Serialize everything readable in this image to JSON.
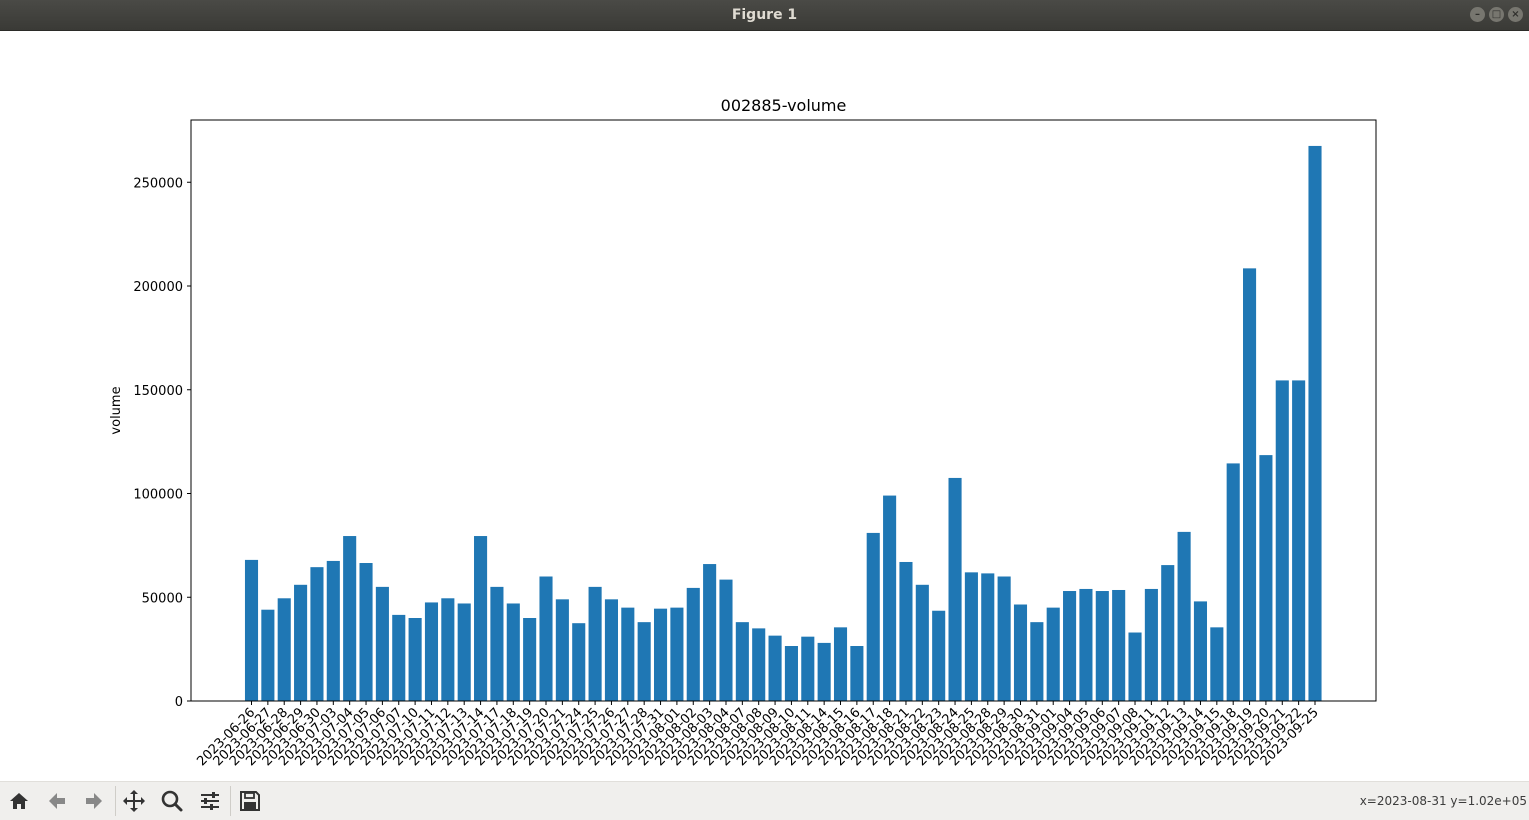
{
  "window": {
    "title": "Figure 1"
  },
  "colors": {
    "bar": "#1f77b4"
  },
  "toolbar": {
    "buttons": [
      "home-icon",
      "back-arrow-icon",
      "forward-arrow-icon",
      "pan-icon",
      "zoom-icon",
      "configure-subplots-icon",
      "save-icon"
    ],
    "coordinates": "x=2023-08-31 y=1.02e+05"
  },
  "chart_data": {
    "type": "bar",
    "title": "002885-volume",
    "xlabel": "",
    "ylabel": "volume",
    "ylim": [
      0,
      280000
    ],
    "yticks": [
      0,
      50000,
      100000,
      150000,
      200000,
      250000
    ],
    "grid": false,
    "categories": [
      "2023-06-26",
      "2023-06-27",
      "2023-06-28",
      "2023-06-29",
      "2023-06-30",
      "2023-07-03",
      "2023-07-04",
      "2023-07-05",
      "2023-07-06",
      "2023-07-07",
      "2023-07-10",
      "2023-07-11",
      "2023-07-12",
      "2023-07-13",
      "2023-07-14",
      "2023-07-17",
      "2023-07-18",
      "2023-07-19",
      "2023-07-20",
      "2023-07-21",
      "2023-07-24",
      "2023-07-25",
      "2023-07-26",
      "2023-07-27",
      "2023-07-28",
      "2023-07-31",
      "2023-08-01",
      "2023-08-02",
      "2023-08-03",
      "2023-08-04",
      "2023-08-07",
      "2023-08-08",
      "2023-08-09",
      "2023-08-10",
      "2023-08-11",
      "2023-08-14",
      "2023-08-15",
      "2023-08-16",
      "2023-08-17",
      "2023-08-18",
      "2023-08-21",
      "2023-08-22",
      "2023-08-23",
      "2023-08-24",
      "2023-08-25",
      "2023-08-28",
      "2023-08-29",
      "2023-08-30",
      "2023-08-31",
      "2023-09-01",
      "2023-09-04",
      "2023-09-05",
      "2023-09-06",
      "2023-09-07",
      "2023-09-08",
      "2023-09-11",
      "2023-09-12",
      "2023-09-13",
      "2023-09-14",
      "2023-09-15",
      "2023-09-18",
      "2023-09-19",
      "2023-09-20",
      "2023-09-21",
      "2023-09-22",
      "2023-09-25"
    ],
    "values": [
      68000,
      44000,
      49500,
      56000,
      64500,
      67500,
      79500,
      66500,
      55000,
      41500,
      40000,
      47500,
      49500,
      47000,
      79500,
      55000,
      47000,
      40000,
      60000,
      49000,
      37500,
      55000,
      49000,
      45000,
      38000,
      44500,
      45000,
      54500,
      66000,
      58500,
      38000,
      35000,
      31500,
      26500,
      31000,
      28000,
      35500,
      26500,
      81000,
      99000,
      67000,
      56000,
      43500,
      107500,
      62000,
      61500,
      60000,
      46500,
      38000,
      45000,
      53000,
      54000,
      53000,
      53500,
      33000,
      54000,
      65500,
      81500,
      48000,
      35500,
      114500,
      208500,
      118500,
      154500,
      154500,
      267500
    ]
  }
}
